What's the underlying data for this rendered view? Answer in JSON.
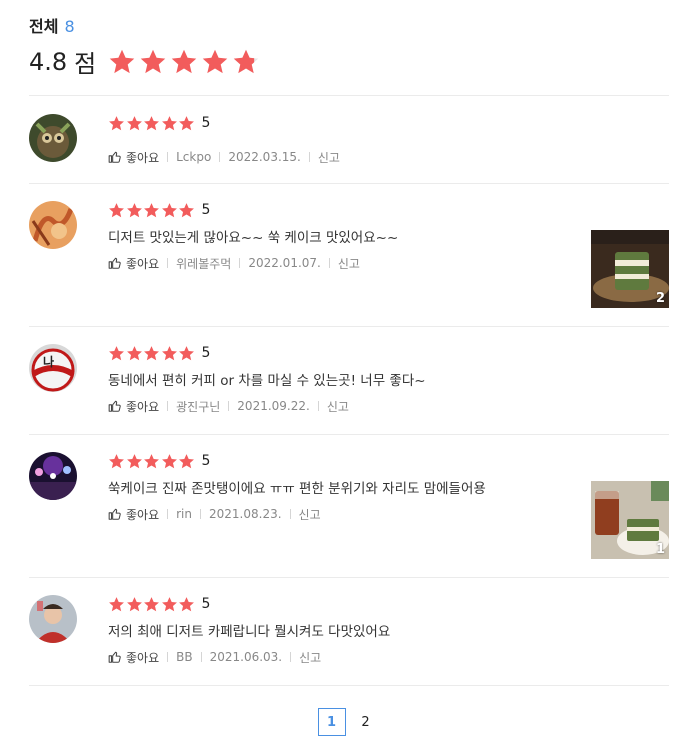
{
  "header": {
    "total_label": "전체",
    "total_count": "8",
    "rating_value": "4.8",
    "rating_unit": "점",
    "rating_fraction": 0.96,
    "star_color": "#f25c5c"
  },
  "reviews": [
    {
      "score": "5",
      "text": "",
      "like_label": "좋아요",
      "author": "Lckpo",
      "date": "2022.03.15.",
      "report_label": "신고",
      "avatar_icon": "owl-avatar"
    },
    {
      "score": "5",
      "text": "디저트 맛있는게 많아요~~ 쑥 케이크 맛있어요~~",
      "like_label": "좋아요",
      "author": "위레볼주먹",
      "date": "2022.01.07.",
      "report_label": "신고",
      "avatar_icon": "illustration-avatar",
      "photo_count": "2"
    },
    {
      "score": "5",
      "text": "동네에서 편히 커피 or 차를 마실 수 있는곳! 너무 좋다~",
      "like_label": "좋아요",
      "author": "광진구닌",
      "date": "2021.09.22.",
      "report_label": "신고",
      "avatar_icon": "ball-avatar"
    },
    {
      "score": "5",
      "text": "쑥케이크 진짜 존맛탱이에요 ㅠㅠ 편한 분위기와 자리도 맘에들어용",
      "like_label": "좋아요",
      "author": "rin",
      "date": "2021.08.23.",
      "report_label": "신고",
      "avatar_icon": "concert-avatar",
      "photo_count": "1"
    },
    {
      "score": "5",
      "text": "저의 최애 디저트 카페랍니다 뭘시켜도 다맛있어요",
      "like_label": "좋아요",
      "author": "BB",
      "date": "2021.06.03.",
      "report_label": "신고",
      "avatar_icon": "person-avatar"
    }
  ],
  "pagination": {
    "pages": [
      "1",
      "2"
    ],
    "current": "1",
    "active_color": "#4a90e2"
  }
}
